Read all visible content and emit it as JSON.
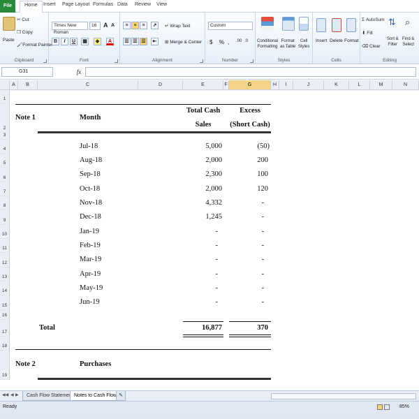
{
  "ribbon_tabs": [
    "File",
    "Home",
    "Insert",
    "Page Layout",
    "Formulas",
    "Data",
    "Review",
    "View"
  ],
  "clipboard": {
    "paste": "Paste",
    "cut": "Cut",
    "copy": "Copy",
    "format_painter": "Format Painter",
    "label": "Clipboard"
  },
  "font": {
    "name": "Times New Roman",
    "size": "16",
    "bold": "B",
    "italic": "I",
    "underline": "U",
    "grow": "A",
    "shrink": "A",
    "color_letter": "A",
    "label": "Font"
  },
  "alignment": {
    "wrap": "Wrap Text",
    "merge": "Merge & Center",
    "label": "Alignment"
  },
  "number": {
    "format": "Custom",
    "currency": "$",
    "percent": "%",
    "comma": ",",
    "label": "Number"
  },
  "styles": {
    "conditional": "Conditional",
    "conditional2": "Formatting",
    "format_table": "Format",
    "format_table2": "as Table",
    "cell_styles": "Cell",
    "cell_styles2": "Styles",
    "label": "Styles"
  },
  "cells": {
    "insert": "Insert",
    "delete": "Delete",
    "format": "Format",
    "label": "Cells"
  },
  "editing": {
    "autosum": "AutoSum",
    "fill": "Fill",
    "clear": "Clear",
    "sort": "Sort &",
    "sort2": "Filter",
    "find": "Find &",
    "find2": "Select",
    "label": "Editing"
  },
  "formula_bar": {
    "name_box": "G31",
    "fx": "fx",
    "value": ""
  },
  "columns": [
    "A",
    "B",
    "C",
    "D",
    "E",
    "F",
    "G",
    "H",
    "I",
    "J",
    "K",
    "L",
    "M",
    "N"
  ],
  "selected_column": "G",
  "rows": [
    "1",
    "2",
    "3",
    "4",
    "5",
    "6",
    "7",
    "8",
    "9",
    "10",
    "11",
    "12",
    "13",
    "14",
    "15",
    "16",
    "17",
    "18",
    "19"
  ],
  "sheet": {
    "note1": "Note 1",
    "month_header": "Month",
    "sales_header_1": "Total Cash",
    "sales_header_2": "Sales",
    "excess_header_1": "Excess",
    "excess_header_2": "(Short Cash)",
    "data": [
      {
        "month": "Jul-18",
        "sales": "5,000",
        "excess": "(50)"
      },
      {
        "month": "Aug-18",
        "sales": "2,000",
        "excess": "200"
      },
      {
        "month": "Sep-18",
        "sales": "2,300",
        "excess": "100"
      },
      {
        "month": "Oct-18",
        "sales": "2,000",
        "excess": "120"
      },
      {
        "month": "Nov-18",
        "sales": "4,332",
        "excess": "-"
      },
      {
        "month": "Dec-18",
        "sales": "1,245",
        "excess": "-"
      },
      {
        "month": "Jan-19",
        "sales": "-",
        "excess": "-"
      },
      {
        "month": "Feb-19",
        "sales": "-",
        "excess": "-"
      },
      {
        "month": "Mar-19",
        "sales": "-",
        "excess": "-"
      },
      {
        "month": "Apr-19",
        "sales": "-",
        "excess": "-"
      },
      {
        "month": "May-19",
        "sales": "-",
        "excess": "-"
      },
      {
        "month": "Jun-19",
        "sales": "-",
        "excess": "-"
      }
    ],
    "total_label": "Total",
    "total_sales": "16,877",
    "total_excess": "370",
    "note2": "Note 2",
    "purchases": "Purchases"
  },
  "sheet_tabs": [
    "Cash Flow Statement",
    "Notes to Cash Flow"
  ],
  "active_sheet": "Notes to Cash Flow",
  "status": {
    "ready": "Ready",
    "zoom": "85%"
  }
}
